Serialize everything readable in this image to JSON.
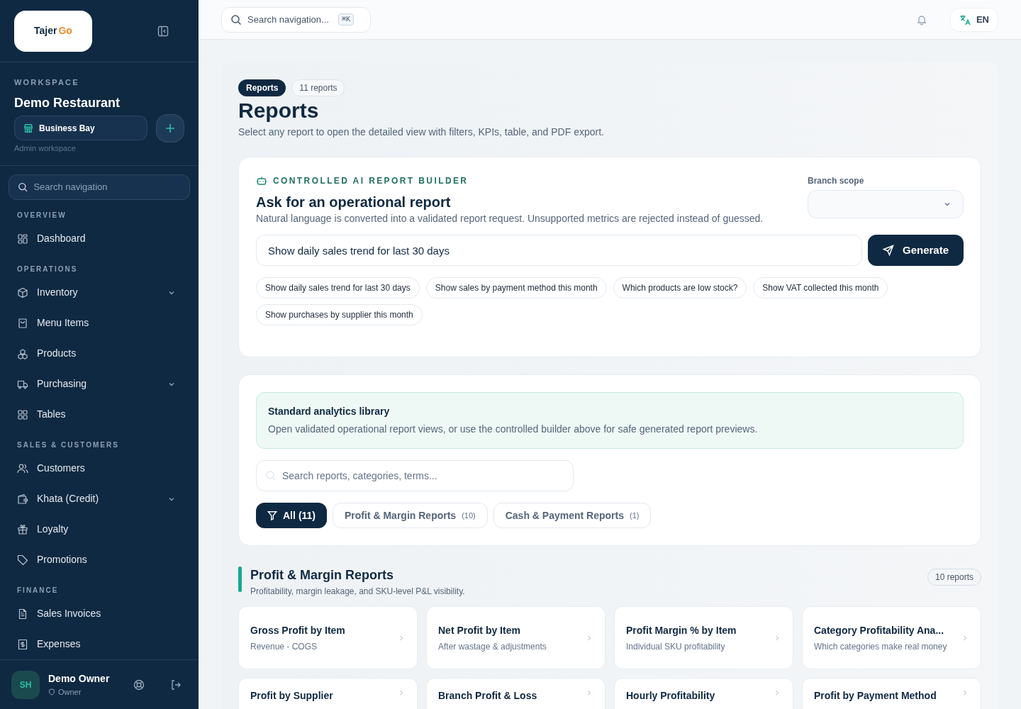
{
  "brand": {
    "name_part_1": "Tajer",
    "name_part_2": "Go"
  },
  "workspace": {
    "heading": "WORKSPACE",
    "name": "Demo Restaurant",
    "branch": "Business Bay",
    "role_note": "Admin workspace"
  },
  "sidebar_search": {
    "placeholder": "Search navigation"
  },
  "nav_sections": [
    {
      "heading": "OVERVIEW",
      "items": [
        {
          "label": "Dashboard",
          "has_submenu": false
        }
      ]
    },
    {
      "heading": "OPERATIONS",
      "items": [
        {
          "label": "Inventory",
          "has_submenu": true
        },
        {
          "label": "Menu Items",
          "has_submenu": false
        },
        {
          "label": "Products",
          "has_submenu": false
        },
        {
          "label": "Purchasing",
          "has_submenu": true
        },
        {
          "label": "Tables",
          "has_submenu": false
        }
      ]
    },
    {
      "heading": "SALES & CUSTOMERS",
      "items": [
        {
          "label": "Customers",
          "has_submenu": false
        },
        {
          "label": "Khata (Credit)",
          "has_submenu": true
        },
        {
          "label": "Loyalty",
          "has_submenu": false
        },
        {
          "label": "Promotions",
          "has_submenu": false
        }
      ]
    },
    {
      "heading": "FINANCE",
      "items": [
        {
          "label": "Sales Invoices",
          "has_submenu": false
        },
        {
          "label": "Expenses",
          "has_submenu": false
        }
      ]
    }
  ],
  "user": {
    "initials": "SH",
    "name": "Demo Owner",
    "role": "Owner"
  },
  "topbar": {
    "search_placeholder": "Search navigation...",
    "shortcut": "⌘K",
    "language": "EN"
  },
  "header": {
    "badge": "Reports",
    "count": "11 reports",
    "title": "Reports",
    "subtitle": "Select any report to open the detailed view with filters, KPIs, table, and PDF export."
  },
  "builder": {
    "eyebrow": "CONTROLLED AI REPORT BUILDER",
    "title": "Ask for an operational report",
    "description": "Natural language is converted into a validated report request. Unsupported metrics are rejected instead of guessed.",
    "scope_label": "Branch scope",
    "query": "Show daily sales trend for last 30 days",
    "generate": "Generate",
    "suggestions": [
      "Show daily sales trend for last 30 days",
      "Show sales by payment method this month",
      "Which products are low stock?",
      "Show VAT collected this month",
      "Show purchases by supplier this month"
    ]
  },
  "library": {
    "title": "Standard analytics library",
    "description": "Open validated operational report views, or use the controlled builder above for safe generated report previews.",
    "search_placeholder": "Search reports, categories, terms...",
    "filters": [
      {
        "label": "All",
        "count": "(11)",
        "selected": true
      },
      {
        "label": "Profit & Margin Reports",
        "count": "(10)",
        "selected": false
      },
      {
        "label": "Cash & Payment Reports",
        "count": "(1)",
        "selected": false
      }
    ]
  },
  "section": {
    "title": "Profit & Margin Reports",
    "description": "Profitability, margin leakage, and SKU-level P&L visibility.",
    "count": "10 reports",
    "reports": [
      {
        "title": "Gross Profit by Item",
        "description": "Revenue - COGS"
      },
      {
        "title": "Net Profit by Item",
        "description": "After wastage & adjustments"
      },
      {
        "title": "Profit Margin % by Item",
        "description": "Individual SKU profitability"
      },
      {
        "title": "Category Profitability Ana...",
        "description": "Which categories make real money"
      },
      {
        "title": "Profit by Supplier"
      },
      {
        "title": "Branch Profit & Loss"
      },
      {
        "title": "Hourly Profitability"
      },
      {
        "title": "Profit by Payment Method"
      }
    ]
  }
}
